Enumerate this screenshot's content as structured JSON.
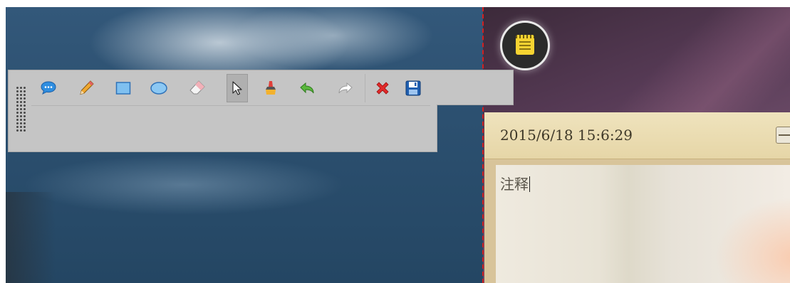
{
  "toolbar": {
    "tools": [
      {
        "icon": "speech-bubble-icon",
        "selected": false
      },
      {
        "icon": "pencil-icon",
        "selected": false
      },
      {
        "icon": "rectangle-icon",
        "selected": false
      },
      {
        "icon": "ellipse-icon",
        "selected": false
      },
      {
        "icon": "eraser-icon",
        "selected": false
      },
      {
        "icon": "cursor-icon",
        "selected": true
      },
      {
        "icon": "paint-brush-icon",
        "selected": false
      },
      {
        "icon": "undo-icon",
        "selected": false
      },
      {
        "icon": "redo-icon",
        "selected": false
      },
      {
        "icon": "close-icon",
        "selected": false
      },
      {
        "icon": "save-icon",
        "selected": false
      }
    ]
  },
  "note": {
    "timestamp": "2015/6/18 15:6:29",
    "text": "注释"
  },
  "colors": {
    "toolbar_bg": "#c5c5c5",
    "crop_line": "#d22020",
    "note_header": "#e6d6a7",
    "note_icon": "#f5d331"
  }
}
